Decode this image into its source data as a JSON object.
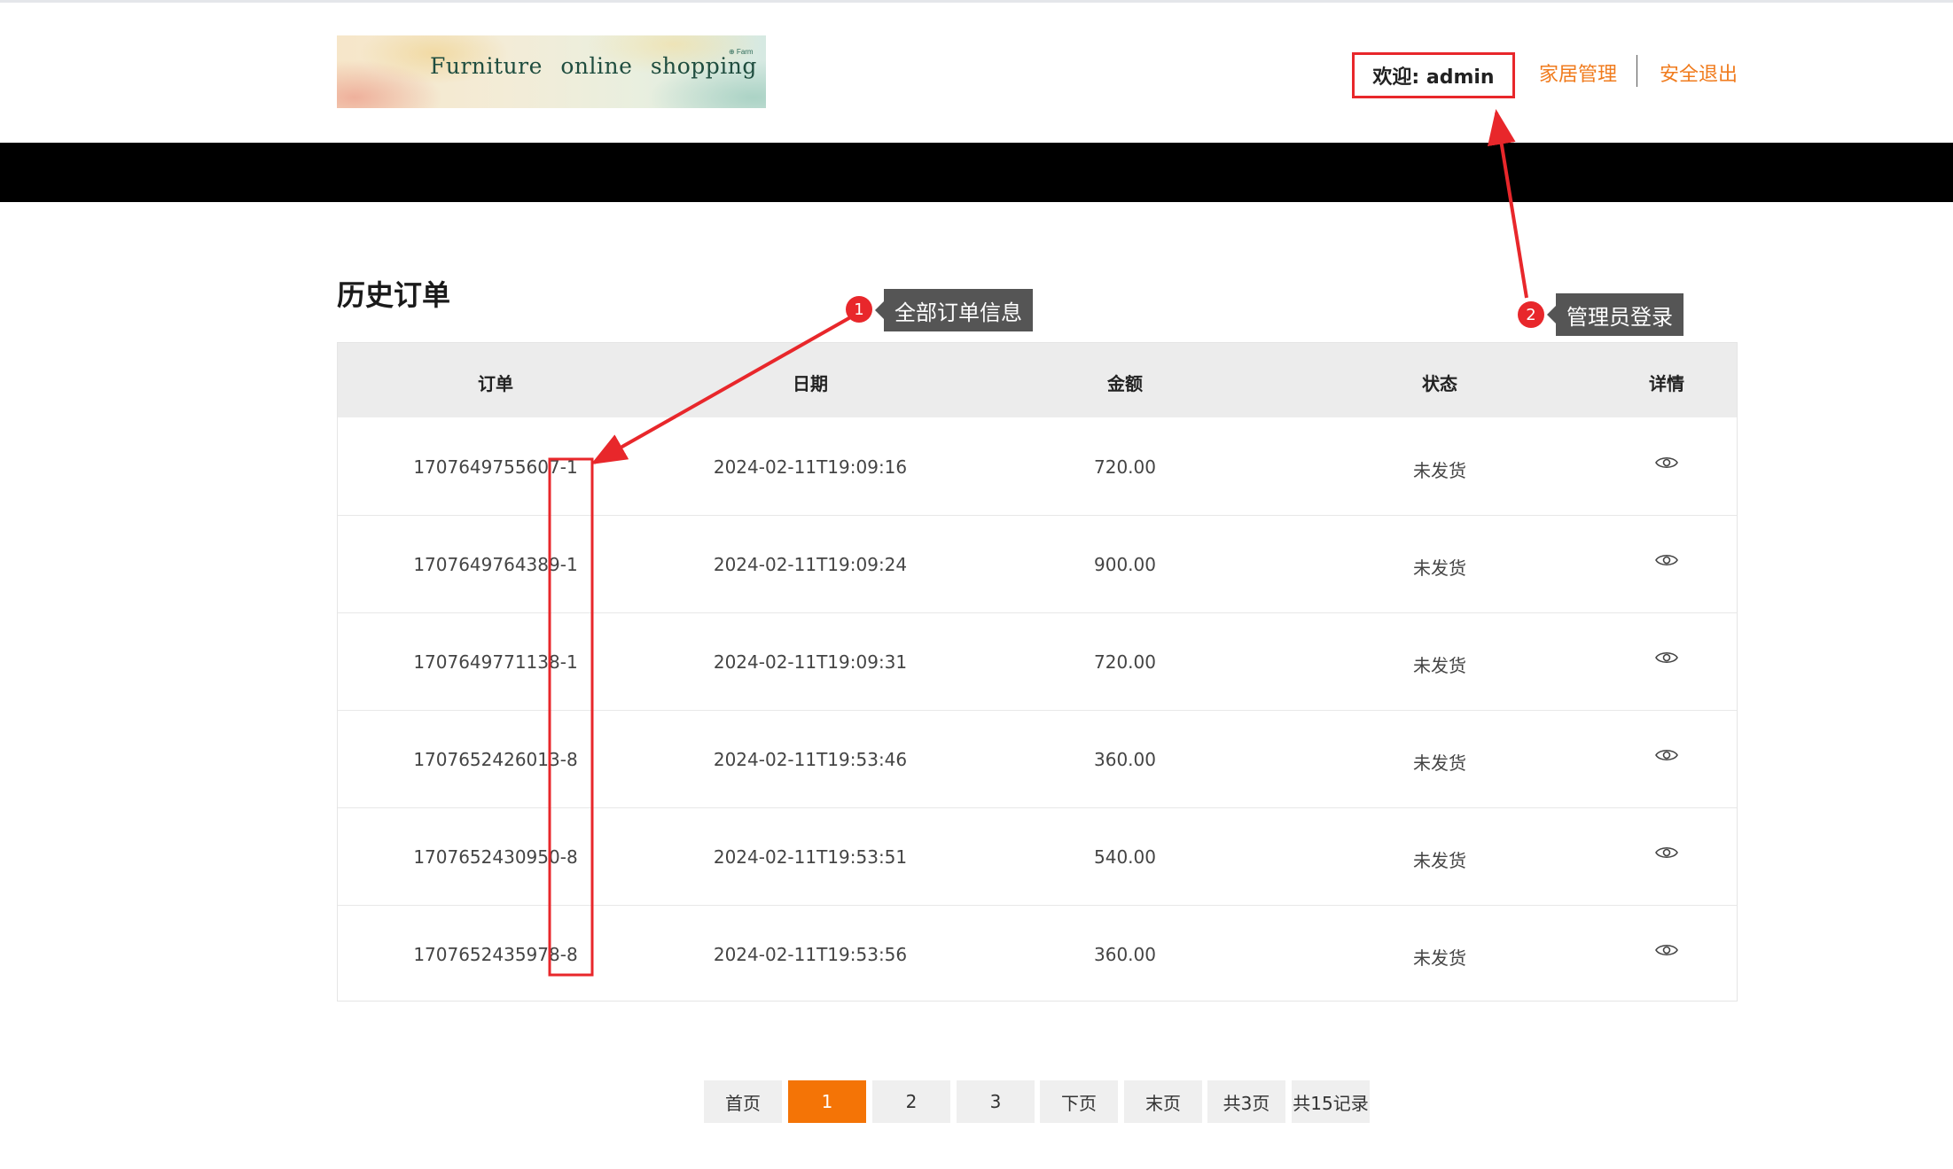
{
  "header": {
    "logo_text": "Furniture online shopping",
    "logo_badge": "⊕ Farm",
    "welcome": "欢迎: admin",
    "nav_manage": "家居管理",
    "nav_logout": "安全退出"
  },
  "page_title": "历史订单",
  "table": {
    "columns": [
      "订单",
      "日期",
      "金额",
      "状态",
      "详情"
    ],
    "rows": [
      {
        "order": "1707649755607-1",
        "date": "2024-02-11T19:09:16",
        "amount": "720.00",
        "status": "未发货"
      },
      {
        "order": "1707649764389-1",
        "date": "2024-02-11T19:09:24",
        "amount": "900.00",
        "status": "未发货"
      },
      {
        "order": "1707649771138-1",
        "date": "2024-02-11T19:09:31",
        "amount": "720.00",
        "status": "未发货"
      },
      {
        "order": "1707652426013-8",
        "date": "2024-02-11T19:53:46",
        "amount": "360.00",
        "status": "未发货"
      },
      {
        "order": "1707652430950-8",
        "date": "2024-02-11T19:53:51",
        "amount": "540.00",
        "status": "未发货"
      },
      {
        "order": "1707652435978-8",
        "date": "2024-02-11T19:53:56",
        "amount": "360.00",
        "status": "未发货"
      }
    ]
  },
  "pagination": {
    "first": "首页",
    "pages": [
      "1",
      "2",
      "3"
    ],
    "current": "1",
    "next": "下页",
    "last": "末页",
    "total_pages": "共3页",
    "total_records": "共15记录"
  },
  "annotations": [
    {
      "number": "1",
      "label": "全部订单信息"
    },
    {
      "number": "2",
      "label": "管理员登录"
    }
  ],
  "colors": {
    "accent": "#f47406",
    "link": "#f07b1d",
    "annotation_red": "#e8272b",
    "tooltip_bg": "#555555"
  }
}
